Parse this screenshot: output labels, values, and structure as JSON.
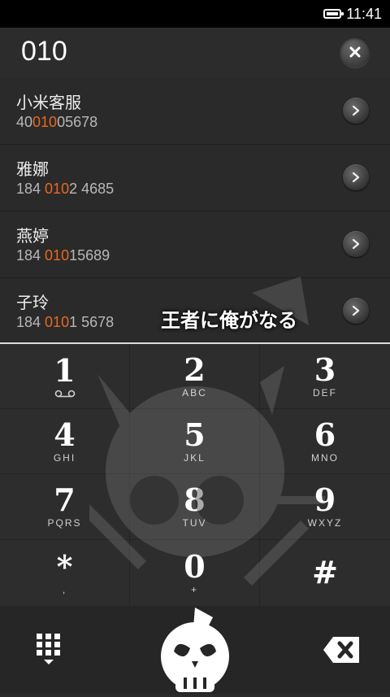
{
  "status_bar": {
    "time": "11:41"
  },
  "search": {
    "query": "010"
  },
  "contacts": [
    {
      "name": "小米客服",
      "number_pre": "40",
      "number_hl": "010",
      "number_post": "05678"
    },
    {
      "name": "雅娜",
      "number_pre": "184 ",
      "number_hl": "010",
      "number_post": "2 4685"
    },
    {
      "name": "燕婷",
      "number_pre": "184 ",
      "number_hl": "010",
      "number_post": "15689"
    },
    {
      "name": "子玲",
      "number_pre": "184 ",
      "number_hl": "010",
      "number_post": "1 5678"
    }
  ],
  "overlay_text": "王者に俺がなる",
  "keypad": [
    {
      "digit": "1",
      "letters": ""
    },
    {
      "digit": "2",
      "letters": "ABC"
    },
    {
      "digit": "3",
      "letters": "DEF"
    },
    {
      "digit": "4",
      "letters": "GHI"
    },
    {
      "digit": "5",
      "letters": "JKL"
    },
    {
      "digit": "6",
      "letters": "MNO"
    },
    {
      "digit": "7",
      "letters": "PQRS"
    },
    {
      "digit": "8",
      "letters": "TUV"
    },
    {
      "digit": "9",
      "letters": "WXYZ"
    },
    {
      "digit": "*",
      "letters": ","
    },
    {
      "digit": "0",
      "letters": "+"
    },
    {
      "digit": "#",
      "letters": ""
    }
  ],
  "colors": {
    "highlight": "#e8681e",
    "background": "#2a2a2a"
  },
  "icons": {
    "voicemail": "voicemail-icon",
    "clear": "close-icon",
    "row_action": "chevron-right-icon",
    "dialpad": "dialpad-grid-icon",
    "call": "skull-call-icon",
    "delete": "backspace-icon"
  }
}
